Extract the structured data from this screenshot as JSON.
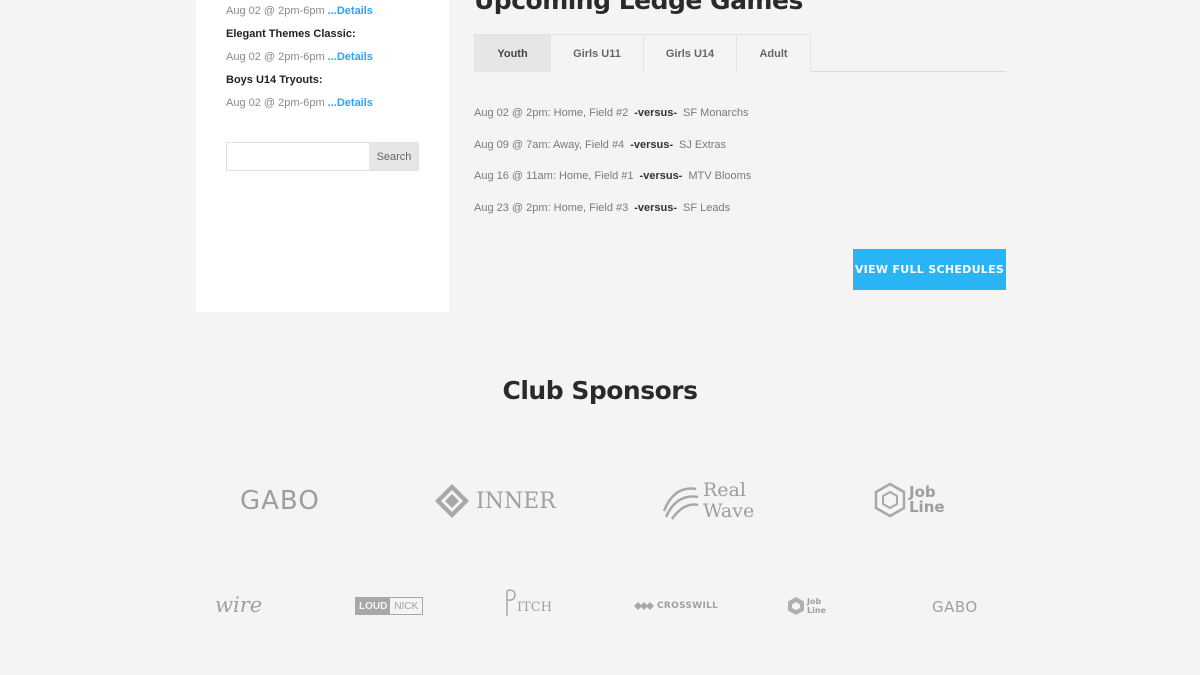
{
  "sidebar": {
    "events": [
      {
        "date": "Aug 02 @ 2pm-6pm",
        "details": "...Details"
      },
      {
        "title": "Elegant Themes Classic:",
        "date": "Aug 02 @ 2pm-6pm",
        "details": "...Details"
      },
      {
        "title": "Boys U14 Tryouts:",
        "date": "Aug 02 @ 2pm-6pm",
        "details": "...Details"
      }
    ],
    "search": {
      "placeholder": "",
      "button": "Search"
    }
  },
  "main": {
    "title": "Upcoming Ledge Games",
    "tabs": [
      "Youth",
      "Girls U11",
      "Girls U14",
      "Adult"
    ],
    "active_tab": "Youth",
    "games": [
      {
        "info": "Aug 02 @ 2pm: Home, Field #2",
        "vs": "-versus-",
        "opponent": "SF Monarchs"
      },
      {
        "info": "Aug 09 @ 7am: Away, Field #4",
        "vs": "-versus-",
        "opponent": "SJ Extras"
      },
      {
        "info": "Aug 16 @ 11am: Home, Field #1",
        "vs": "-versus-",
        "opponent": "MTV Blooms"
      },
      {
        "info": "Aug 23 @ 2pm: Home, Field #3",
        "vs": "-versus-",
        "opponent": "SF Leads"
      }
    ],
    "schedule_button": "VIEW FULL SCHEDULES",
    "accent_color": "#2ab4f6"
  },
  "sponsors": {
    "title": "Club Sponsors",
    "logos_row1": [
      {
        "icon": "gabo-logo",
        "text": "GABO"
      },
      {
        "icon": "inner-logo",
        "text": "INNER"
      },
      {
        "icon": "realwave-logo",
        "line1": "Real",
        "line2": "Wave"
      },
      {
        "icon": "jobline-logo",
        "line1": "Job",
        "line2": "Line"
      }
    ],
    "logos_row2": [
      {
        "icon": "wire-logo",
        "text": "wire"
      },
      {
        "icon": "loudnick-logo",
        "text_a": "LOUD",
        "text_b": "NICK"
      },
      {
        "icon": "pitch-logo",
        "text": "ITCH"
      },
      {
        "icon": "crosswill-logo",
        "text": "CROSSWILL"
      },
      {
        "icon": "jobline-small-logo",
        "line1": "Job",
        "line2": "Line"
      },
      {
        "icon": "gabo-small-logo",
        "text": "GABO"
      }
    ]
  }
}
